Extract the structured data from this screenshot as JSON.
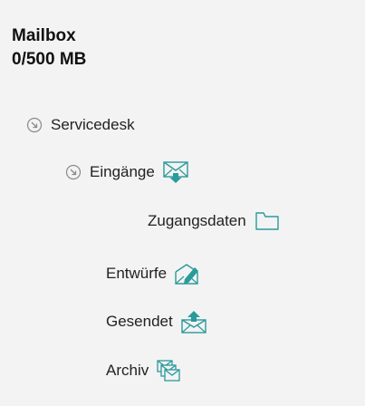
{
  "mailbox": {
    "title": "Mailbox",
    "usage": "0/500 MB"
  },
  "tree": {
    "servicedesk": {
      "label": "Servicedesk",
      "icon": "collapse-circle-icon",
      "expanded": true
    },
    "eingaenge": {
      "label": "Eingänge",
      "icon": "inbox-icon",
      "expanded": true
    },
    "zugangsdaten": {
      "label": "Zugangsdaten",
      "icon": "folder-icon"
    },
    "entwuerfe": {
      "label": "Entwürfe",
      "icon": "draft-icon"
    },
    "gesendet": {
      "label": "Gesendet",
      "icon": "sent-icon"
    },
    "archiv": {
      "label": "Archiv",
      "icon": "archive-icon"
    }
  },
  "colors": {
    "background": "#f3f3f3",
    "icon_teal": "#2a9a9c",
    "chevron_gray": "#8a8a8a",
    "text": "#222222"
  }
}
